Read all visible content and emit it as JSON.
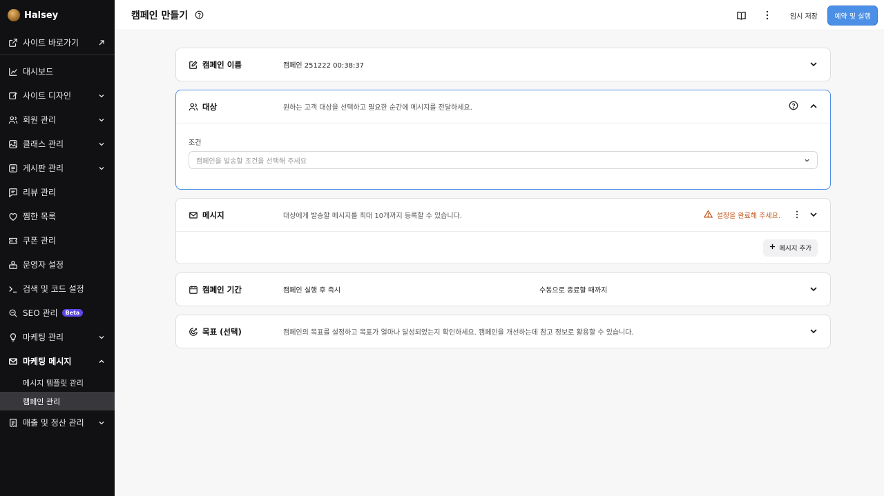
{
  "app": {
    "brand": "Halsey"
  },
  "sidebar": {
    "site_link": "사이트 바로가기",
    "items": [
      {
        "label": "대시보드"
      },
      {
        "label": "사이트 디자인"
      },
      {
        "label": "회원 관리"
      },
      {
        "label": "클래스 관리"
      },
      {
        "label": "게시판 관리"
      },
      {
        "label": "리뷰 관리"
      },
      {
        "label": "찜한 목록"
      },
      {
        "label": "쿠폰 관리"
      },
      {
        "label": "운영자 설정"
      },
      {
        "label": "검색 및 코드 설정"
      },
      {
        "label": "SEO 관리",
        "badge": "Beta"
      },
      {
        "label": "마케팅 관리"
      },
      {
        "label": "마케팅 메시지"
      },
      {
        "label": "매출 및 정산 관리"
      }
    ],
    "subitems": [
      {
        "label": "메시지 템플릿 관리"
      },
      {
        "label": "캠페인 관리"
      }
    ]
  },
  "header": {
    "title": "캠페인 만들기",
    "draft_label": "임시 저장",
    "primary_label": "예약 및 실행"
  },
  "cards": {
    "name": {
      "title": "캠페인 이름",
      "value": "캠페인 251222 00:38:37"
    },
    "audience": {
      "title": "대상",
      "desc": "원하는 고객 대상을 선택하고 필요한 순간에 메시지를 전달하세요.",
      "condition_label": "조건",
      "condition_placeholder": "캠페인을 발송할 조건을 선택해 주세요"
    },
    "message": {
      "title": "메시지",
      "desc": "대상에게 발송할 메시지를 최대 10개까지 등록할 수 있습니다.",
      "warning": "설정을 완료해 주세요.",
      "add_label": "메시지 추가"
    },
    "period": {
      "title": "캠페인 기간",
      "start": "캠페인 실행 후 즉시",
      "end": "수동으로 종료할 때까지"
    },
    "goal": {
      "title": "목표 (선택)",
      "desc": "캠페인의 목표를 설정하고 목표가 얼마나 달성되었는지 확인하세요. 캠페인을 개선하는데 참고 정보로 활용할 수 있습니다."
    }
  },
  "colors": {
    "accent": "#4b8fe6",
    "warning": "#c4561a",
    "sidebar_bg": "#111113",
    "beta": "#5b46e8"
  }
}
